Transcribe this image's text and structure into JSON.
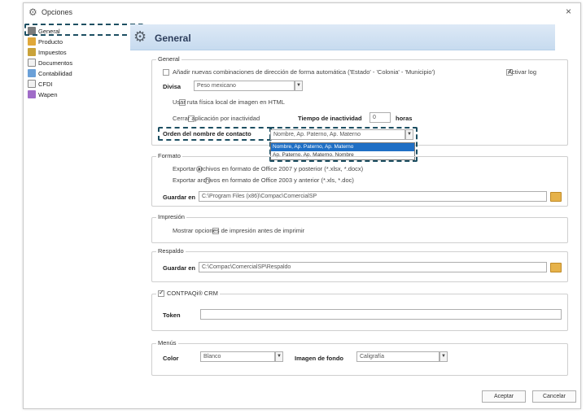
{
  "window": {
    "title": "Opciones",
    "close": "×"
  },
  "sidebar": {
    "items": [
      {
        "label": "General",
        "color": "#7b7b7b"
      },
      {
        "label": "Producto",
        "color": "#e0a83a"
      },
      {
        "label": "Impuestos",
        "color": "#c9a23a"
      },
      {
        "label": "Documentos",
        "color": "#f2f2f2"
      },
      {
        "label": "Contabilidad",
        "color": "#6aa0d8"
      },
      {
        "label": "CFDI",
        "color": "#f2f2f2"
      },
      {
        "label": "Wapen",
        "color": "#a06cc8"
      }
    ]
  },
  "header": {
    "title": "General"
  },
  "general": {
    "label": "General",
    "add_combinations": "Añadir nuevas combinaciones de dirección de forma automática ('Estado' - 'Colonia' - 'Municipio')",
    "activate_log": "Activar log",
    "currency_label": "Divisa",
    "currency_value": "Peso mexicano",
    "local_path": "Usar ruta física local de imagen en HTML",
    "close_inactive": "Cerrar aplicación por inactividad",
    "inactive_time_label": "Tiempo de inactividad",
    "inactive_time_value": "0",
    "hours": "horas",
    "contact_order_label": "Orden del nombre de contacto",
    "contact_order_value": "Nombre, Ap. Paterno, Ap. Materno",
    "contact_order_options": [
      "Nombre, Ap. Paterno, Ap. Materno",
      "Ap. Paterno, Ap. Materno, Nombre"
    ]
  },
  "format": {
    "label": "Formato",
    "option_2007": "Exportar archivos en formato de Office 2007 y posterior (*.xlsx, *.docx)",
    "option_2003": "Exportar archivos en formato de Office 2003 y anterior (*.xls, *.doc)",
    "save_label": "Guardar en",
    "save_path": "C:\\Program Files (x86)\\Compac\\ComercialSP"
  },
  "print": {
    "label": "Impresión",
    "show_options": "Mostrar opciones de impresión antes de imprimir"
  },
  "backup": {
    "label": "Respaldo",
    "save_label": "Guardar en",
    "save_path": "C:\\Compac\\ComercialSP\\Respaldo"
  },
  "crm": {
    "label": "CONTPAQi® CRM",
    "token_label": "Token",
    "token_value": ""
  },
  "menus": {
    "label": "Menús",
    "color_label": "Color",
    "color_value": "Blanco",
    "bg_label": "Imagen de fondo",
    "bg_value": "Caligrafía"
  },
  "footer": {
    "accept": "Aceptar",
    "cancel": "Cancelar"
  }
}
